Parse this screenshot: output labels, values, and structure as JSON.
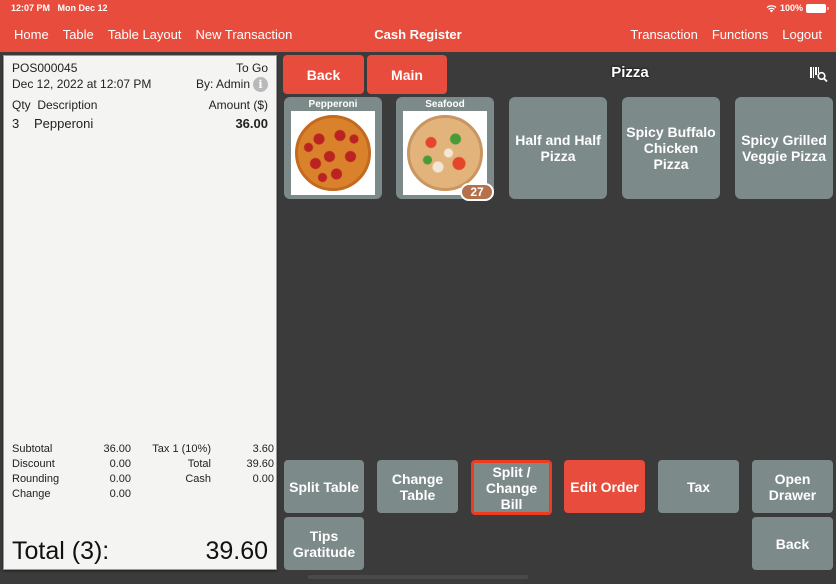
{
  "status_bar": {
    "time": "12:07 PM",
    "date": "Mon Dec 12",
    "battery": "100%",
    "wifi_icon": "wifi-icon",
    "battery_icon": "battery-icon"
  },
  "nav": {
    "left": [
      "Home",
      "Table",
      "Table Layout",
      "New Transaction"
    ],
    "title": "Cash Register",
    "right": [
      "Transaction",
      "Functions",
      "Logout"
    ]
  },
  "receipt": {
    "number": "POS000045",
    "order_type": "To Go",
    "datetime": "Dec 12, 2022 at 12:07 PM",
    "by": "By: Admin",
    "col_qty": "Qty",
    "col_desc": "Description",
    "col_amount": "Amount ($)",
    "items": [
      {
        "qty": "3",
        "name": "Pepperoni",
        "amount": "36.00"
      }
    ],
    "summary": {
      "subtotal_label": "Subtotal",
      "subtotal": "36.00",
      "tax_label": "Tax 1 (10%)",
      "tax": "3.60",
      "discount_label": "Discount",
      "discount": "0.00",
      "total_label": "Total",
      "total": "39.60",
      "rounding_label": "Rounding",
      "rounding": "0.00",
      "cash_label": "Cash",
      "cash": "0.00",
      "change_label": "Change",
      "change": "0.00"
    },
    "grand_label": "Total (3):",
    "grand_total": "39.60"
  },
  "menu": {
    "back": "Back",
    "main": "Main",
    "category": "Pizza",
    "items": [
      {
        "name": "Pepperoni",
        "type": "image"
      },
      {
        "name": "Seafood",
        "type": "image",
        "badge": "27"
      },
      {
        "name": "Half and Half Pizza",
        "type": "text"
      },
      {
        "name": "Spicy Buffalo Chicken Pizza",
        "type": "text"
      },
      {
        "name": "Spicy Grilled Veggie Pizza",
        "type": "text"
      }
    ]
  },
  "functions": {
    "split_table": "Split Table",
    "change_table": "Change Table",
    "split_bill": "Split / Change Bill",
    "edit_order": "Edit Order",
    "tax": "Tax",
    "open_drawer": "Open Drawer",
    "tips": "Tips Gratitude",
    "back": "Back"
  },
  "colors": {
    "accent": "#e74c3c",
    "button_grey": "#7d8a8a",
    "background": "#3b3b3b",
    "highlight": "#ef3b1f"
  }
}
